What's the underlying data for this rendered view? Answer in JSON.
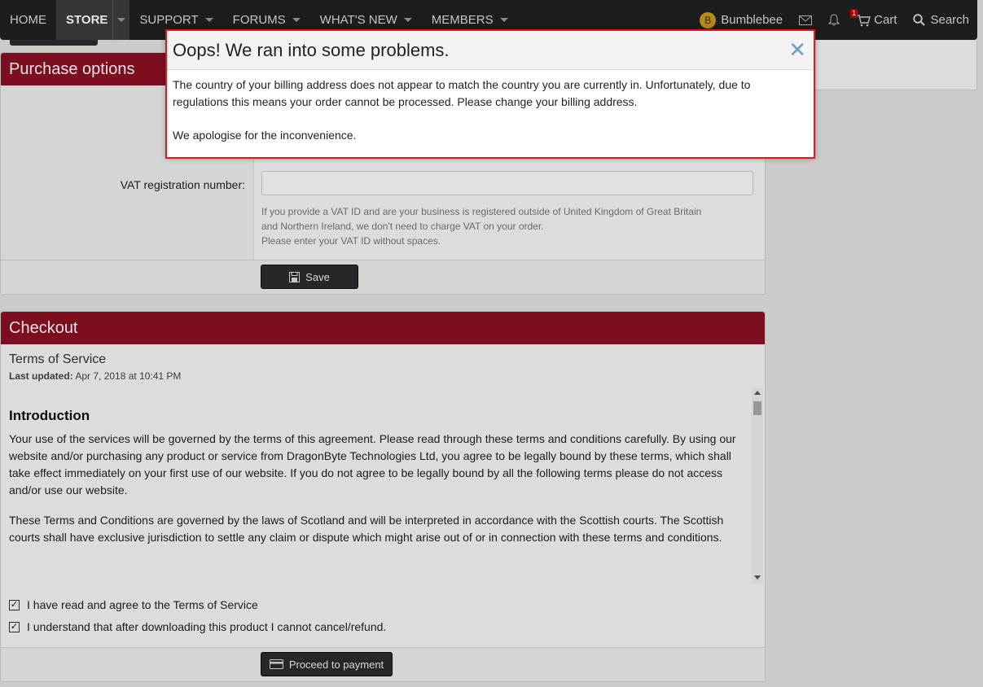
{
  "nav": {
    "items": [
      {
        "label": "HOME",
        "has_menu": false
      },
      {
        "label": "STORE",
        "has_menu": true,
        "active": true
      },
      {
        "label": "SUPPORT",
        "has_menu": true
      },
      {
        "label": "FORUMS",
        "has_menu": true
      },
      {
        "label": "WHAT'S NEW",
        "has_menu": true
      },
      {
        "label": "MEMBERS",
        "has_menu": true
      }
    ],
    "user": {
      "avatar_letter": "B",
      "name": "Bumblebee"
    },
    "cart": {
      "label": "Cart",
      "badge": "1"
    },
    "search": {
      "label": "Search"
    }
  },
  "purchase": {
    "title": "Purchase options",
    "vat_label": "VAT registration number:",
    "vat_value": "",
    "vat_help": [
      "If you provide a VAT ID and are your business is registered outside of United Kingdom of Great Britain",
      "and Northern Ireland, we don't need to charge VAT on your order.",
      "Please enter your VAT ID without spaces."
    ],
    "save_label": "Save"
  },
  "checkout": {
    "title": "Checkout",
    "tos_title": "Terms of Service",
    "last_updated_label": "Last updated:",
    "last_updated_value": "Apr 7, 2018 at 10:41 PM",
    "heading": "Introduction",
    "paragraphs": [
      "Your use of the services will be governed by the terms of this agreement. Please read through these terms and conditions carefully. By using our website and/or purchasing any product or service from DragonByte Technologies Ltd, you agree to be legally bound by these terms, which shall take effect immediately on your first use of our website. If you do not agree to be legally bound by all the following terms please do not access and/or use our website.",
      "These Terms and Conditions are governed by the laws of Scotland and will be interpreted in accordance with the Scottish courts. The Scottish courts shall have exclusive jurisdiction to settle any claim or dispute which might arise out of or in connection with these terms and conditions."
    ],
    "agree_tos": {
      "label": "I have read and agree to the Terms of Service",
      "checked": true
    },
    "agree_refund": {
      "label": "I understand that after downloading this product I cannot cancel/refund.",
      "checked": true
    },
    "proceed_label": "Proceed to payment"
  },
  "modal": {
    "title": "Oops! We ran into some problems.",
    "message": "The country of your billing address does not appear to match the country you are currently in. Unfortunately, due to regulations this means your order cannot be processed. Please change your billing address.",
    "apology": "We apologise for the inconvenience.",
    "close_symbol": "✕"
  },
  "colors": {
    "brand": "#8b1023",
    "navbar": "#1f2122",
    "modal_outline": "#e01818",
    "close": "#6aa0c8"
  }
}
